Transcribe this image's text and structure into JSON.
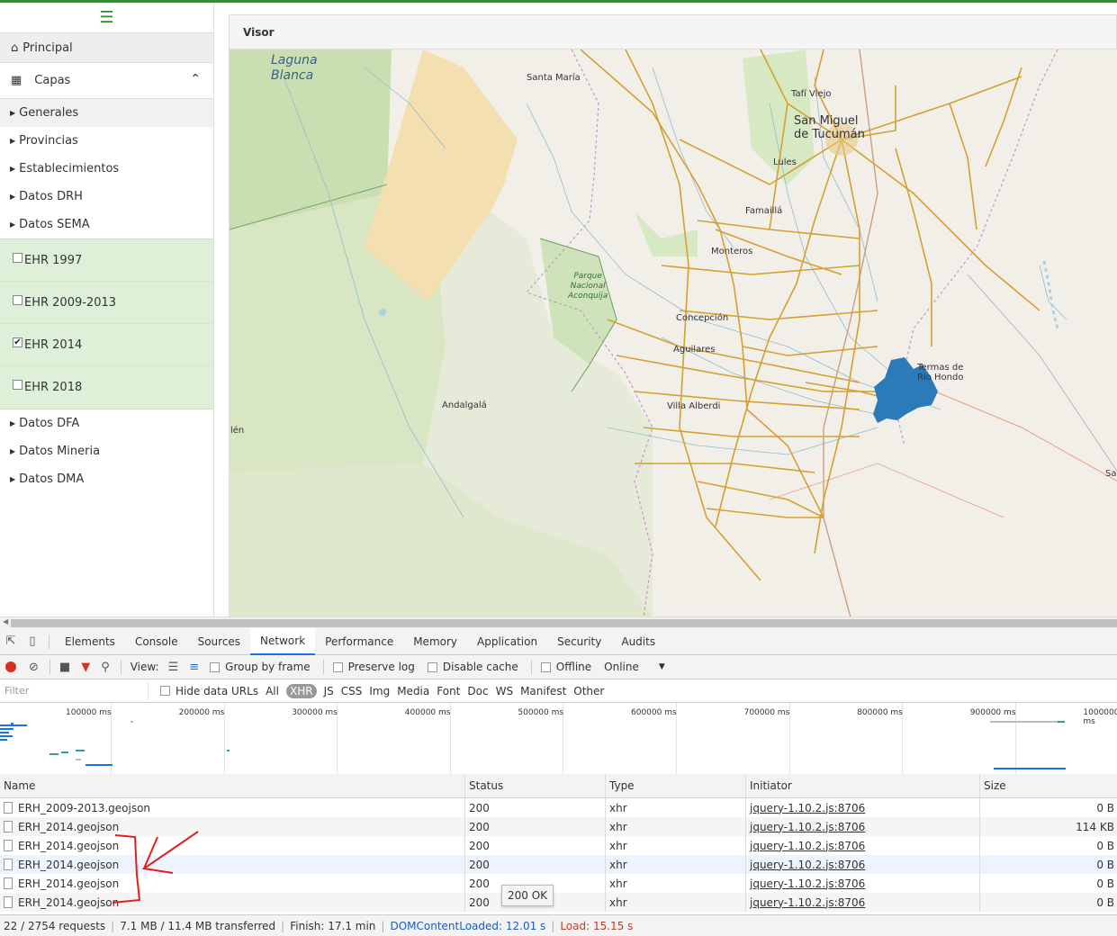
{
  "sidebar": {
    "menu_icon": "hamburger-icon",
    "principal_label": "Principal",
    "capas_label": "Capas",
    "items_top": [
      "Generales",
      "Provincias",
      "Establecimientos",
      "Datos DRH",
      "Datos SEMA"
    ],
    "layers": [
      {
        "label": "EHR 1997",
        "checked": false
      },
      {
        "label": "EHR 2009-2013",
        "checked": false
      },
      {
        "label": "EHR 2014",
        "checked": true
      },
      {
        "label": "EHR 2018",
        "checked": false
      }
    ],
    "items_bottom": [
      "Datos DFA",
      "Datos Mineria",
      "Datos DMA"
    ]
  },
  "visor": {
    "title": "Visor",
    "map_labels": {
      "laguna": "Laguna\nBlanca",
      "santa_maria": "Santa María",
      "tafi_viejo": "Tafí Viejo",
      "san_miguel": "San Miguel\nde Tucumán",
      "lules": "Lules",
      "famailla": "Famaillá",
      "monteros": "Monteros",
      "parque": "Parque\nNacional\nAconquija",
      "concepcion": "Concepción",
      "aguilares": "Aguilares",
      "termas": "Termas de\nRío Hondo",
      "andalgala": "Andalgalá",
      "villa_alberdi": "Villa Alberdi",
      "belen_partial": "lén",
      "sa_partial": "Sa"
    },
    "colors": {
      "road": "#d4a02f",
      "water": "#8fbcd4",
      "highlight": "#2b7bb9",
      "forest": "#c8dfb0",
      "sand": "#f1d9a6"
    }
  },
  "devtools": {
    "tabs": [
      "Elements",
      "Console",
      "Sources",
      "Network",
      "Performance",
      "Memory",
      "Application",
      "Security",
      "Audits"
    ],
    "active_tab": "Network",
    "toolbar": {
      "view_label": "View:",
      "group_by_frame": "Group by frame",
      "preserve_log": "Preserve log",
      "disable_cache": "Disable cache",
      "offline": "Offline",
      "online": "Online"
    },
    "filter": {
      "placeholder": "Filter",
      "hide_data_urls": "Hide data URLs",
      "types": [
        "All",
        "XHR",
        "JS",
        "CSS",
        "Img",
        "Media",
        "Font",
        "Doc",
        "WS",
        "Manifest",
        "Other"
      ],
      "selected_type": "XHR"
    },
    "timeline_ticks": [
      "100000 ms",
      "200000 ms",
      "300000 ms",
      "400000 ms",
      "500000 ms",
      "600000 ms",
      "700000 ms",
      "800000 ms",
      "900000 ms",
      "1000000 ms"
    ],
    "columns": [
      "Name",
      "Status",
      "Type",
      "Initiator",
      "Size"
    ],
    "rows": [
      {
        "name": "ERH_2009-2013.geojson",
        "status": "200",
        "type": "xhr",
        "initiator": "jquery-1.10.2.js:8706",
        "size": "0 B"
      },
      {
        "name": "ERH_2014.geojson",
        "status": "200",
        "type": "xhr",
        "initiator": "jquery-1.10.2.js:8706",
        "size": "114 KB"
      },
      {
        "name": "ERH_2014.geojson",
        "status": "200",
        "type": "xhr",
        "initiator": "jquery-1.10.2.js:8706",
        "size": "0 B"
      },
      {
        "name": "ERH_2014.geojson",
        "status": "200",
        "type": "xhr",
        "initiator": "jquery-1.10.2.js:8706",
        "size": "0 B"
      },
      {
        "name": "ERH_2014.geojson",
        "status": "200",
        "type": "xhr",
        "initiator": "jquery-1.10.2.js:8706",
        "size": "0 B"
      },
      {
        "name": "ERH_2014.geojson",
        "status": "200",
        "type": "xhr",
        "initiator": "jquery-1.10.2.js:8706",
        "size": "0 B"
      }
    ],
    "tooltip": "200 OK",
    "status": {
      "requests": "22 / 2754 requests",
      "transferred": "7.1 MB / 11.4 MB transferred",
      "finish": "Finish: 17.1 min",
      "dom": "DOMContentLoaded: 12.01 s",
      "load": "Load: 15.15 s"
    }
  }
}
